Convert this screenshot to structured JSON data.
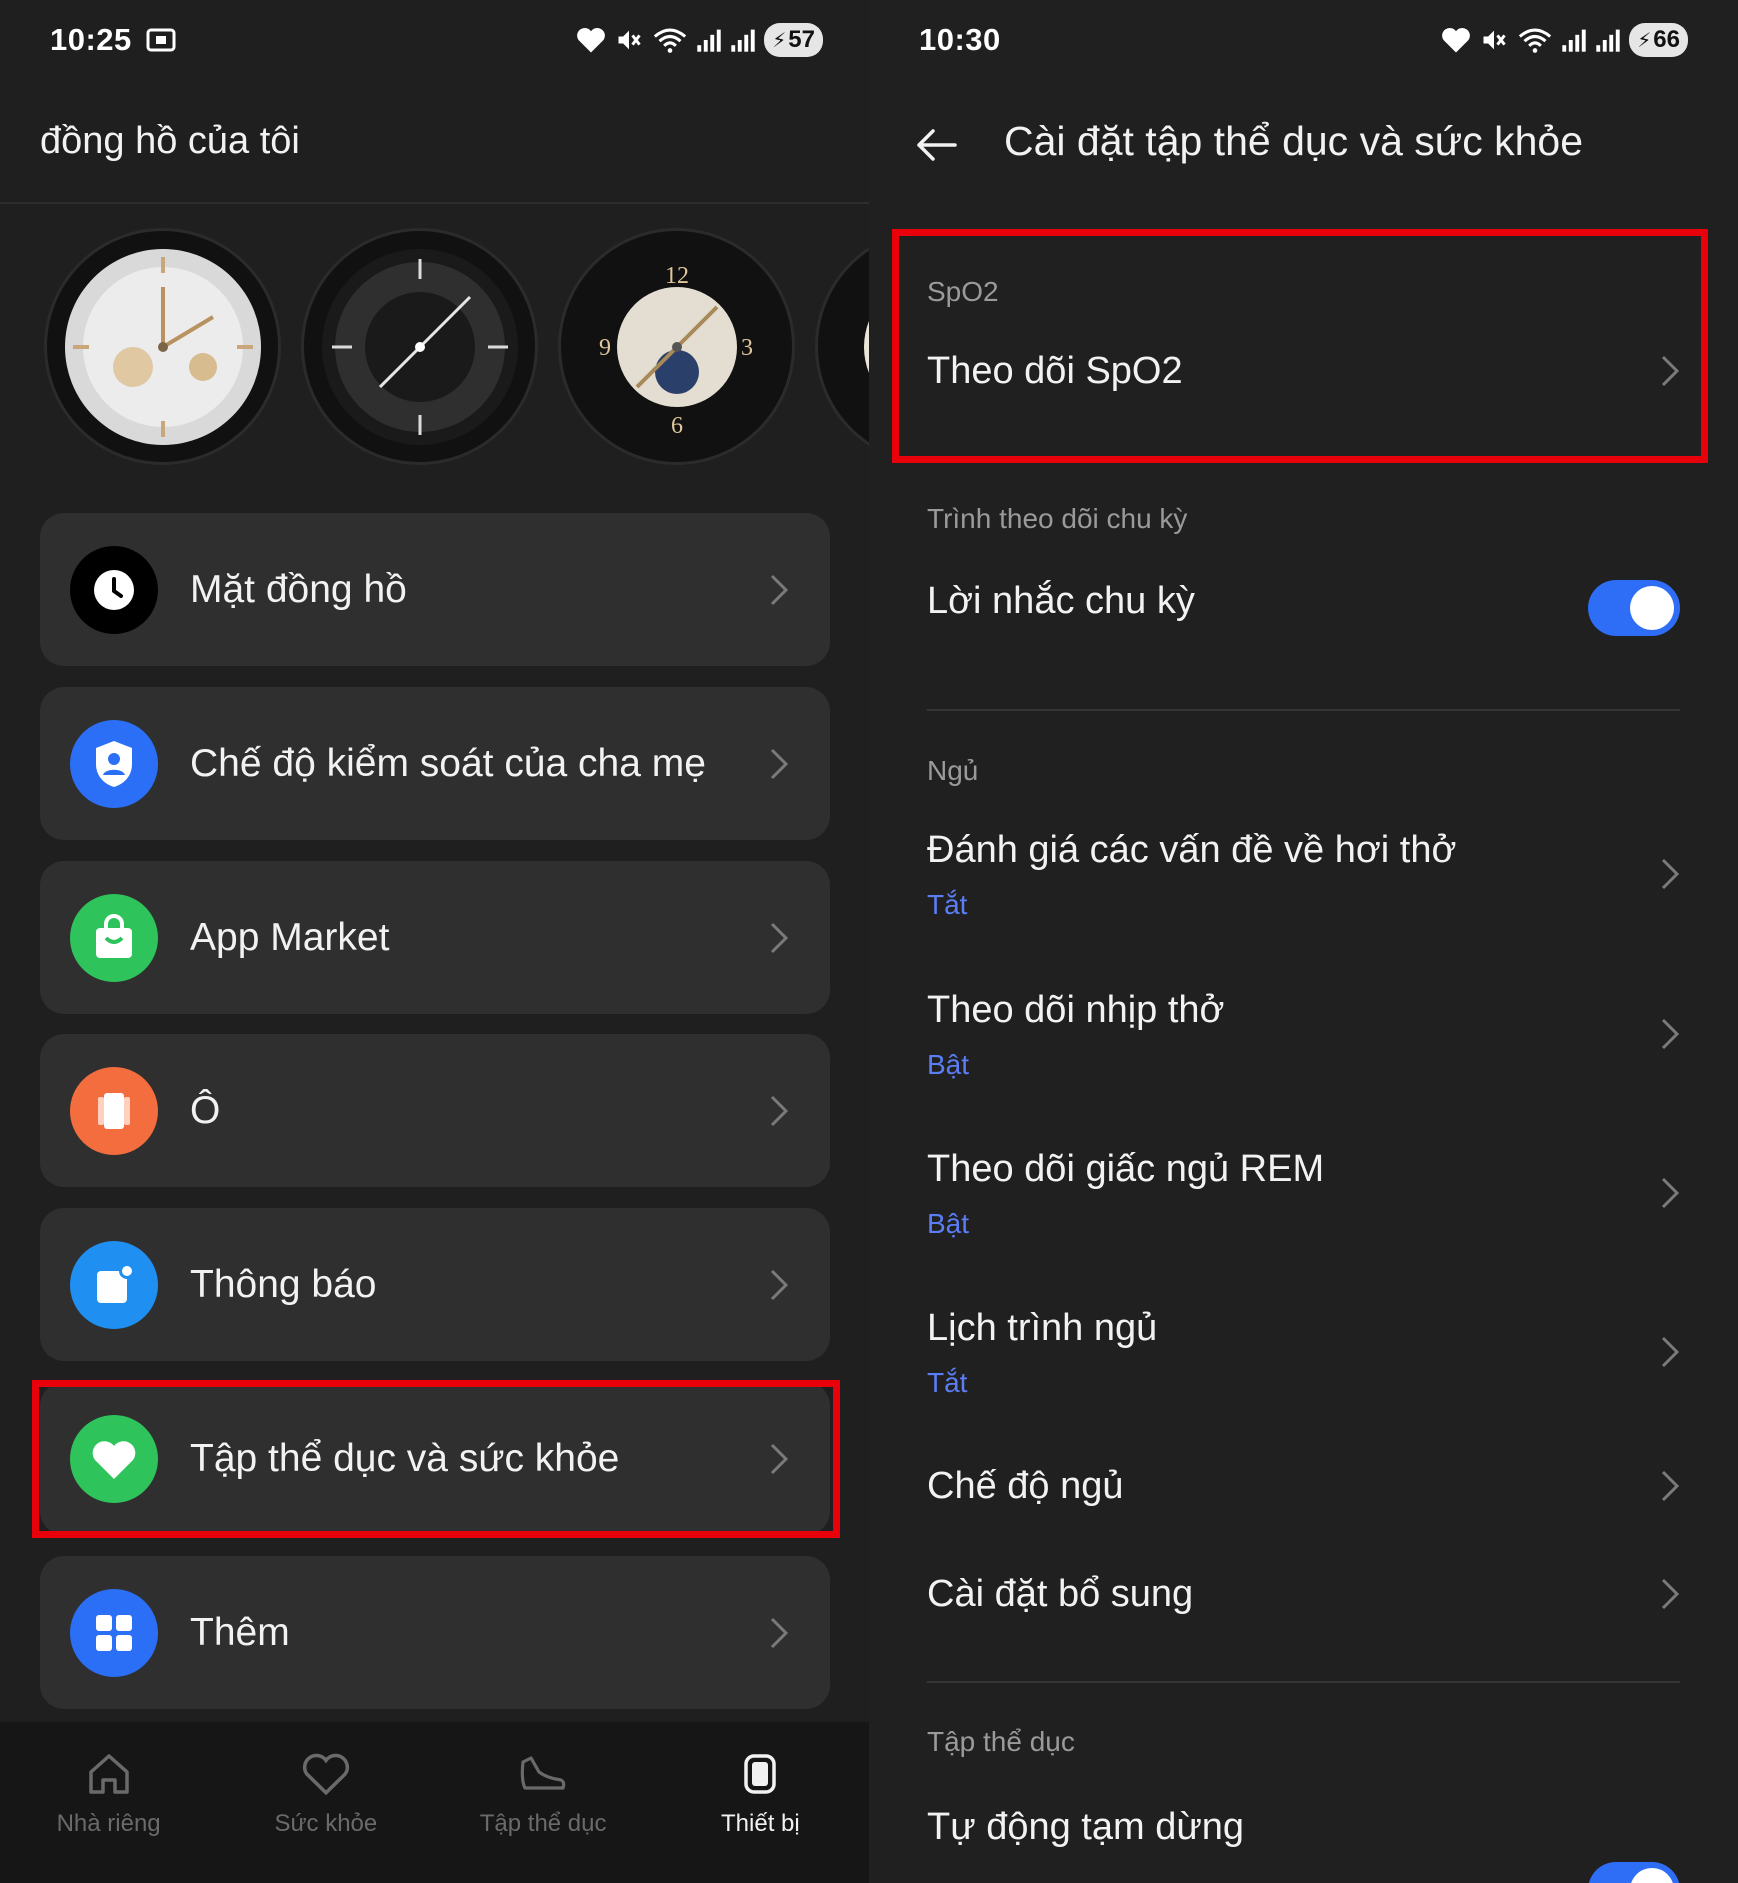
{
  "left": {
    "status": {
      "time": "10:25",
      "battery": "57"
    },
    "title": "đồng hồ của tôi",
    "watch_faces": [
      "watch-face-1",
      "watch-face-2",
      "watch-face-3",
      "watch-face-4"
    ],
    "menu": [
      {
        "label": "Mặt đồng hồ",
        "icon": "clock-icon",
        "color": "#000000"
      },
      {
        "label": "Chế độ kiểm soát của cha mẹ",
        "icon": "shield-person-icon",
        "color": "#2a6ff5"
      },
      {
        "label": "App Market",
        "icon": "shopping-bag-icon",
        "color": "#2ec35b"
      },
      {
        "label": "Ô",
        "icon": "tile-icon",
        "color": "#f36d3e"
      },
      {
        "label": "Thông báo",
        "icon": "notification-icon",
        "color": "#1f8ff2"
      },
      {
        "label": "Tập thể dục và sức khỏe",
        "icon": "heart-icon",
        "color": "#2ec35b"
      },
      {
        "label": "Thêm",
        "icon": "grid-icon",
        "color": "#2a6ff5"
      }
    ],
    "nav": [
      {
        "label": "Nhà riêng",
        "icon": "home-icon"
      },
      {
        "label": "Sức khỏe",
        "icon": "heart-outline-icon"
      },
      {
        "label": "Tập thể dục",
        "icon": "shoe-icon"
      },
      {
        "label": "Thiết bị",
        "icon": "watch-icon",
        "active": true
      }
    ]
  },
  "right": {
    "status": {
      "time": "10:30",
      "battery": "66"
    },
    "title": "Cài đặt tập thể dục và sức khỏe",
    "sections": {
      "spo2": {
        "label": "SpO2",
        "row": "Theo dõi SpO2"
      },
      "cycle": {
        "label": "Trình theo dõi chu kỳ",
        "row": "Lời nhắc chu kỳ",
        "toggle": true
      },
      "sleep": {
        "label": "Ngủ",
        "rows": [
          {
            "title": "Đánh giá các vấn đề về hơi thở",
            "sub": "Tắt"
          },
          {
            "title": "Theo dõi nhịp thở",
            "sub": "Bật"
          },
          {
            "title": "Theo dõi giấc ngủ REM",
            "sub": "Bật"
          },
          {
            "title": "Lịch trình ngủ",
            "sub": "Tắt"
          },
          {
            "title": "Chế độ ngủ"
          },
          {
            "title": "Cài đặt bổ sung"
          }
        ]
      },
      "exercise": {
        "label": "Tập thể dục",
        "row": "Tự động tạm dừng",
        "toggle": true
      }
    }
  },
  "colors": {
    "highlight": "#e8000b",
    "accent_blue": "#2e6df6",
    "sub_text": "#5b7df5"
  }
}
